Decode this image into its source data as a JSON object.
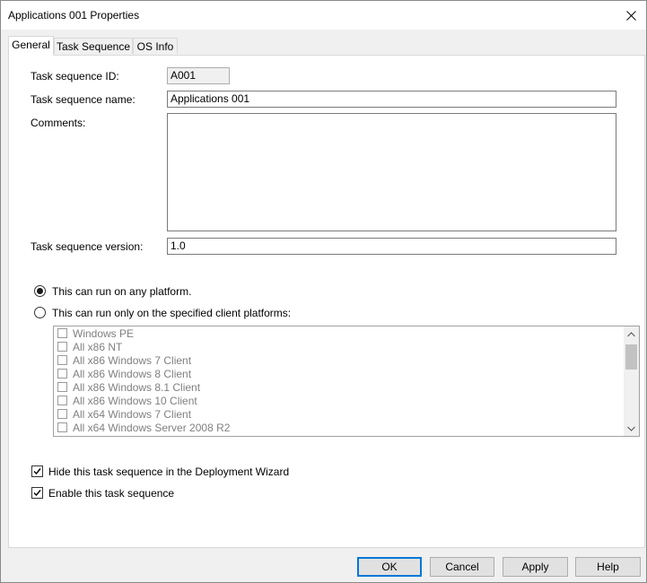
{
  "window": {
    "title": "Applications 001 Properties"
  },
  "tabs": [
    {
      "label": "General",
      "active": true
    },
    {
      "label": "Task Sequence",
      "active": false
    },
    {
      "label": "OS Info",
      "active": false
    }
  ],
  "general": {
    "id_label": "Task sequence ID:",
    "id_value": "A001",
    "name_label": "Task sequence name:",
    "name_value": "Applications 001",
    "comments_label": "Comments:",
    "comments_value": "",
    "version_label": "Task sequence version:",
    "version_value": "1.0",
    "radio_any_label": "This can run on any platform.",
    "radio_any_selected": true,
    "radio_specific_label": "This can run only on the specified client platforms:",
    "radio_specific_selected": false,
    "platforms": [
      {
        "label": "Windows PE",
        "checked": false
      },
      {
        "label": "All x86 NT",
        "checked": false
      },
      {
        "label": "All x86 Windows 7 Client",
        "checked": false
      },
      {
        "label": "All x86 Windows 8 Client",
        "checked": false
      },
      {
        "label": "All x86 Windows 8.1 Client",
        "checked": false
      },
      {
        "label": "All x86 Windows 10 Client",
        "checked": false
      },
      {
        "label": "All x64 Windows 7 Client",
        "checked": false
      },
      {
        "label": "All x64 Windows Server 2008 R2",
        "checked": false
      }
    ],
    "hide_label": "Hide this task sequence in the Deployment Wizard",
    "hide_checked": true,
    "enable_label": "Enable this task sequence",
    "enable_checked": true
  },
  "buttons": {
    "ok": "OK",
    "cancel": "Cancel",
    "apply": "Apply",
    "help": "Help"
  },
  "icons": {
    "close": "close-icon",
    "scroll_up": "chevron-up-icon",
    "scroll_down": "chevron-down-icon",
    "check": "checkmark-icon"
  }
}
